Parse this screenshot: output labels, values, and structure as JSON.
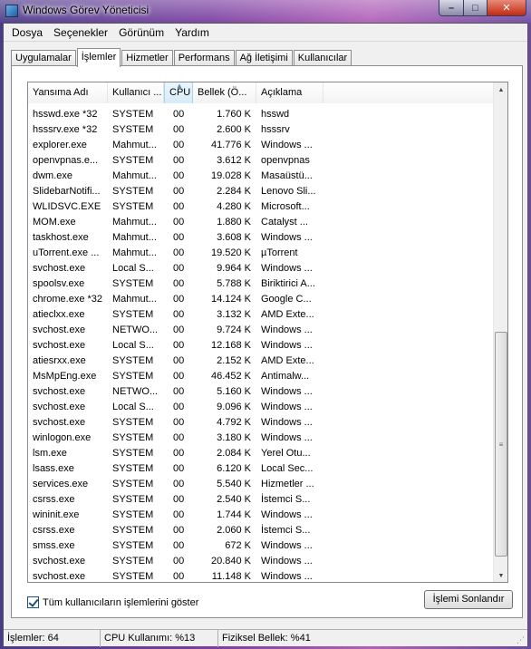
{
  "window": {
    "title": "Windows Görev Yöneticisi",
    "min": "–",
    "max": "□",
    "close": "✕"
  },
  "menu": [
    "Dosya",
    "Seçenekler",
    "Görünüm",
    "Yardım"
  ],
  "tabs": [
    "Uygulamalar",
    "İşlemler",
    "Hizmetler",
    "Performans",
    "Ağ İletişimi",
    "Kullanıcılar"
  ],
  "active_tab": "İşlemler",
  "columns": {
    "name": "Yansıma Adı",
    "user": "Kullanıcı ...",
    "cpu": "CPU",
    "mem": "Bellek (Ö...",
    "desc": "Açıklama"
  },
  "processes": [
    {
      "name": "hsswd.exe *32",
      "user": "SYSTEM",
      "cpu": "00",
      "mem": "1.760 K",
      "desc": "hsswd"
    },
    {
      "name": "hsssrv.exe *32",
      "user": "SYSTEM",
      "cpu": "00",
      "mem": "2.600 K",
      "desc": "hsssrv"
    },
    {
      "name": "explorer.exe",
      "user": "Mahmut...",
      "cpu": "00",
      "mem": "41.776 K",
      "desc": "Windows ..."
    },
    {
      "name": "openvpnas.e...",
      "user": "SYSTEM",
      "cpu": "00",
      "mem": "3.612 K",
      "desc": "openvpnas"
    },
    {
      "name": "dwm.exe",
      "user": "Mahmut...",
      "cpu": "00",
      "mem": "19.028 K",
      "desc": "Masaüstü..."
    },
    {
      "name": "SlidebarNotifi...",
      "user": "SYSTEM",
      "cpu": "00",
      "mem": "2.284 K",
      "desc": "Lenovo Sli..."
    },
    {
      "name": "WLIDSVC.EXE",
      "user": "SYSTEM",
      "cpu": "00",
      "mem": "4.280 K",
      "desc": "Microsoft..."
    },
    {
      "name": "MOM.exe",
      "user": "Mahmut...",
      "cpu": "00",
      "mem": "1.880 K",
      "desc": "Catalyst ..."
    },
    {
      "name": "taskhost.exe",
      "user": "Mahmut...",
      "cpu": "00",
      "mem": "3.608 K",
      "desc": "Windows ..."
    },
    {
      "name": "uTorrent.exe ...",
      "user": "Mahmut...",
      "cpu": "00",
      "mem": "19.520 K",
      "desc": "µTorrent"
    },
    {
      "name": "svchost.exe",
      "user": "Local S...",
      "cpu": "00",
      "mem": "9.964 K",
      "desc": "Windows ..."
    },
    {
      "name": "spoolsv.exe",
      "user": "SYSTEM",
      "cpu": "00",
      "mem": "5.788 K",
      "desc": "Biriktirici A..."
    },
    {
      "name": "chrome.exe *32",
      "user": "Mahmut...",
      "cpu": "00",
      "mem": "14.124 K",
      "desc": "Google C..."
    },
    {
      "name": "atieclxx.exe",
      "user": "SYSTEM",
      "cpu": "00",
      "mem": "3.132 K",
      "desc": "AMD Exte..."
    },
    {
      "name": "svchost.exe",
      "user": "NETWO...",
      "cpu": "00",
      "mem": "9.724 K",
      "desc": "Windows ..."
    },
    {
      "name": "svchost.exe",
      "user": "Local S...",
      "cpu": "00",
      "mem": "12.168 K",
      "desc": "Windows ..."
    },
    {
      "name": "atiesrxx.exe",
      "user": "SYSTEM",
      "cpu": "00",
      "mem": "2.152 K",
      "desc": "AMD Exte..."
    },
    {
      "name": "MsMpEng.exe",
      "user": "SYSTEM",
      "cpu": "00",
      "mem": "46.452 K",
      "desc": "Antimalw..."
    },
    {
      "name": "svchost.exe",
      "user": "NETWO...",
      "cpu": "00",
      "mem": "5.160 K",
      "desc": "Windows ..."
    },
    {
      "name": "svchost.exe",
      "user": "Local S...",
      "cpu": "00",
      "mem": "9.096 K",
      "desc": "Windows ..."
    },
    {
      "name": "svchost.exe",
      "user": "SYSTEM",
      "cpu": "00",
      "mem": "4.792 K",
      "desc": "Windows ..."
    },
    {
      "name": "winlogon.exe",
      "user": "SYSTEM",
      "cpu": "00",
      "mem": "3.180 K",
      "desc": "Windows ..."
    },
    {
      "name": "lsm.exe",
      "user": "SYSTEM",
      "cpu": "00",
      "mem": "2.084 K",
      "desc": "Yerel Otu..."
    },
    {
      "name": "lsass.exe",
      "user": "SYSTEM",
      "cpu": "00",
      "mem": "6.120 K",
      "desc": "Local Sec..."
    },
    {
      "name": "services.exe",
      "user": "SYSTEM",
      "cpu": "00",
      "mem": "5.540 K",
      "desc": "Hizmetler ..."
    },
    {
      "name": "csrss.exe",
      "user": "SYSTEM",
      "cpu": "00",
      "mem": "2.540 K",
      "desc": "İstemci S..."
    },
    {
      "name": "wininit.exe",
      "user": "SYSTEM",
      "cpu": "00",
      "mem": "1.744 K",
      "desc": "Windows ..."
    },
    {
      "name": "csrss.exe",
      "user": "SYSTEM",
      "cpu": "00",
      "mem": "2.060 K",
      "desc": "İstemci S..."
    },
    {
      "name": "smss.exe",
      "user": "SYSTEM",
      "cpu": "00",
      "mem": "672 K",
      "desc": "Windows ..."
    },
    {
      "name": "svchost.exe",
      "user": "SYSTEM",
      "cpu": "00",
      "mem": "20.840 K",
      "desc": "Windows ..."
    },
    {
      "name": "svchost.exe",
      "user": "SYSTEM",
      "cpu": "00",
      "mem": "11.148 K",
      "desc": "Windows ..."
    }
  ],
  "show_all_label": "Tüm kullanıcıların işlemlerini göster",
  "show_all_checked": true,
  "end_process_label": "İşlemi Sonlandır",
  "status": {
    "processes": "İşlemler: 64",
    "cpu": "CPU Kullanımı: %13",
    "memory": "Fiziksel Bellek: %41"
  }
}
